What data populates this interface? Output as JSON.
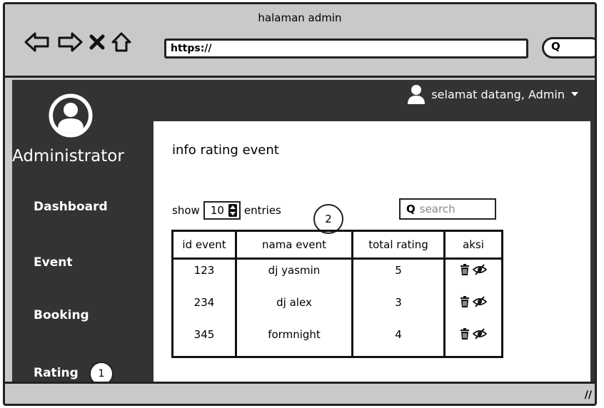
{
  "window": {
    "title": "halaman admin"
  },
  "browser": {
    "url": "https://",
    "search_glyph": "Q",
    "nav_icons": [
      "back-arrow-icon",
      "forward-arrow-icon",
      "close-x-icon",
      "home-icon"
    ]
  },
  "header": {
    "welcome": "selamat datang, Admin"
  },
  "sidebar": {
    "brand": "Administrator",
    "items": [
      {
        "label": "Dashboard"
      },
      {
        "label": "Event"
      },
      {
        "label": "Booking"
      },
      {
        "label": "Rating",
        "badge": "1"
      }
    ]
  },
  "main": {
    "title": "info rating event",
    "show_label": "show",
    "entries_value": "10",
    "entries_label": "entries",
    "annotation_badge": "2",
    "search_placeholder": "search",
    "table": {
      "headers": [
        "id event",
        "nama event",
        "total rating",
        "aksi"
      ],
      "rows": [
        {
          "id": "123",
          "name": "dj yasmin",
          "rating": "5"
        },
        {
          "id": "234",
          "name": "dj alex",
          "rating": "3"
        },
        {
          "id": "345",
          "name": "formnight",
          "rating": "4"
        }
      ],
      "action_icons": [
        "trash-icon",
        "hide-eye-icon"
      ]
    }
  },
  "colors": {
    "chrome": "#c9c9c9",
    "app_bg": "#333333",
    "panel_bg": "#ffffff"
  }
}
